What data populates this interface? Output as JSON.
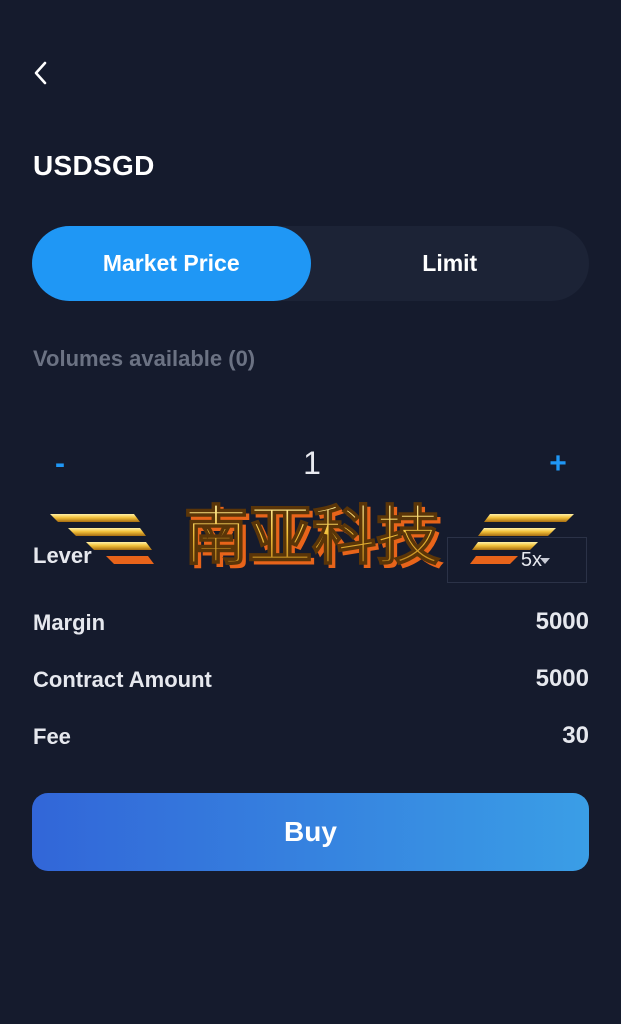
{
  "header": {
    "back_icon": "chevron-left-icon",
    "title": "USDSGD"
  },
  "order_type_tabs": [
    {
      "label": "Market Price",
      "active": true
    },
    {
      "label": "Limit",
      "active": false
    }
  ],
  "volumes_available": "Volumes available (0)",
  "quantity": {
    "minus_label": "-",
    "value": "1",
    "plus_label": "+"
  },
  "lever": {
    "label": "Lever",
    "selected": "5x"
  },
  "details": {
    "margin_label": "Margin",
    "margin_value": "5000",
    "contract_amount_label": "Contract Amount",
    "contract_amount_value": "5000",
    "fee_label": "Fee",
    "fee_value": "30"
  },
  "buy_button": {
    "label": "Buy"
  },
  "watermark": {
    "text": "南亚科技"
  },
  "colors": {
    "background": "#151b2d",
    "accent": "#1f97f5",
    "tab_track": "#1c2336",
    "muted_text": "#6b7283",
    "buy_gradient_start": "#3266d8",
    "buy_gradient_end": "#3a9ee6",
    "watermark_gold": "#f2c13a",
    "watermark_orange": "#e8641a"
  }
}
